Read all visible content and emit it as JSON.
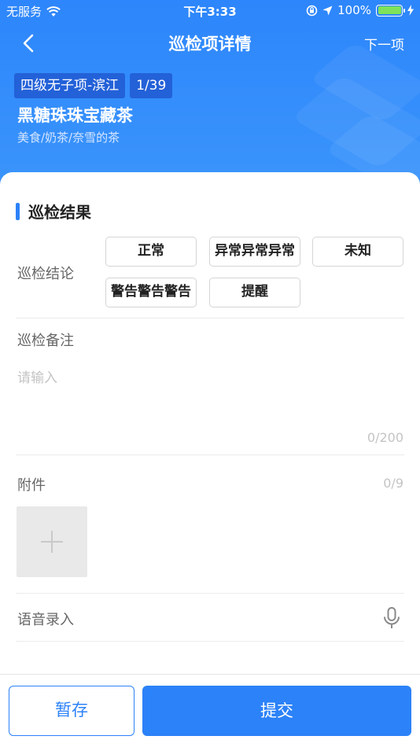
{
  "status_bar": {
    "carrier": "无服务",
    "time": "下午3:33",
    "battery": "100%",
    "battery_level": 1.0,
    "battery_color": "#7ee25a"
  },
  "nav": {
    "title": "巡检项详情",
    "next_label": "下一项",
    "back_icon": "chevron-left-icon"
  },
  "item": {
    "tag": "四级无子项-滨江",
    "progress": "1/39",
    "name": "黑糖珠珠宝藏茶",
    "category": "美食/奶茶/奈雪的茶"
  },
  "result_section": {
    "title": "巡检结果",
    "conclusion_label": "巡检结论",
    "options": [
      "正常",
      "异常异常异常",
      "未知",
      "警告警告警告",
      "提醒"
    ]
  },
  "remark": {
    "label": "巡检备注",
    "placeholder": "请输入",
    "counter": "0/200"
  },
  "attachment": {
    "label": "附件",
    "counter": "0/9",
    "add_icon": "plus-icon"
  },
  "voice": {
    "label": "语音录入",
    "icon": "microphone-icon"
  },
  "actions": {
    "save_label": "暂存",
    "submit_label": "提交"
  },
  "colors": {
    "primary": "#2c82f8",
    "header_bg": "#2d86fb",
    "tag_bg": "#2361d8"
  }
}
